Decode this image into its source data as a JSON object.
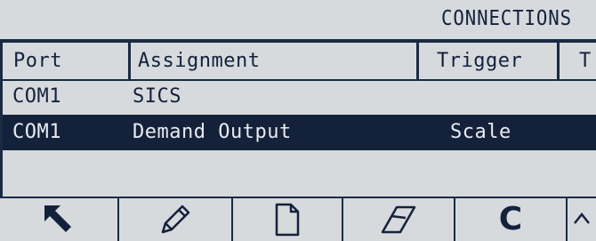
{
  "header": {
    "title": "CONNECTIONS"
  },
  "table": {
    "columns": [
      "Port",
      "Assignment",
      "Trigger",
      "T"
    ],
    "rows": [
      {
        "port": "COM1",
        "assignment": "SICS",
        "trigger": ""
      },
      {
        "port": "COM1",
        "assignment": "Demand Output",
        "trigger": "Scale",
        "selected": true
      }
    ]
  },
  "softkeys": [
    {
      "icon": "exit-arrow-icon"
    },
    {
      "icon": "pencil-icon"
    },
    {
      "icon": "new-document-icon"
    },
    {
      "icon": "eraser-icon"
    },
    {
      "icon": "clear-icon",
      "label": "C"
    },
    {
      "icon": "scroll-up-icon"
    }
  ],
  "colors": {
    "background": "#d6dadd",
    "foreground": "#14213a",
    "highlight": "#14213a"
  }
}
